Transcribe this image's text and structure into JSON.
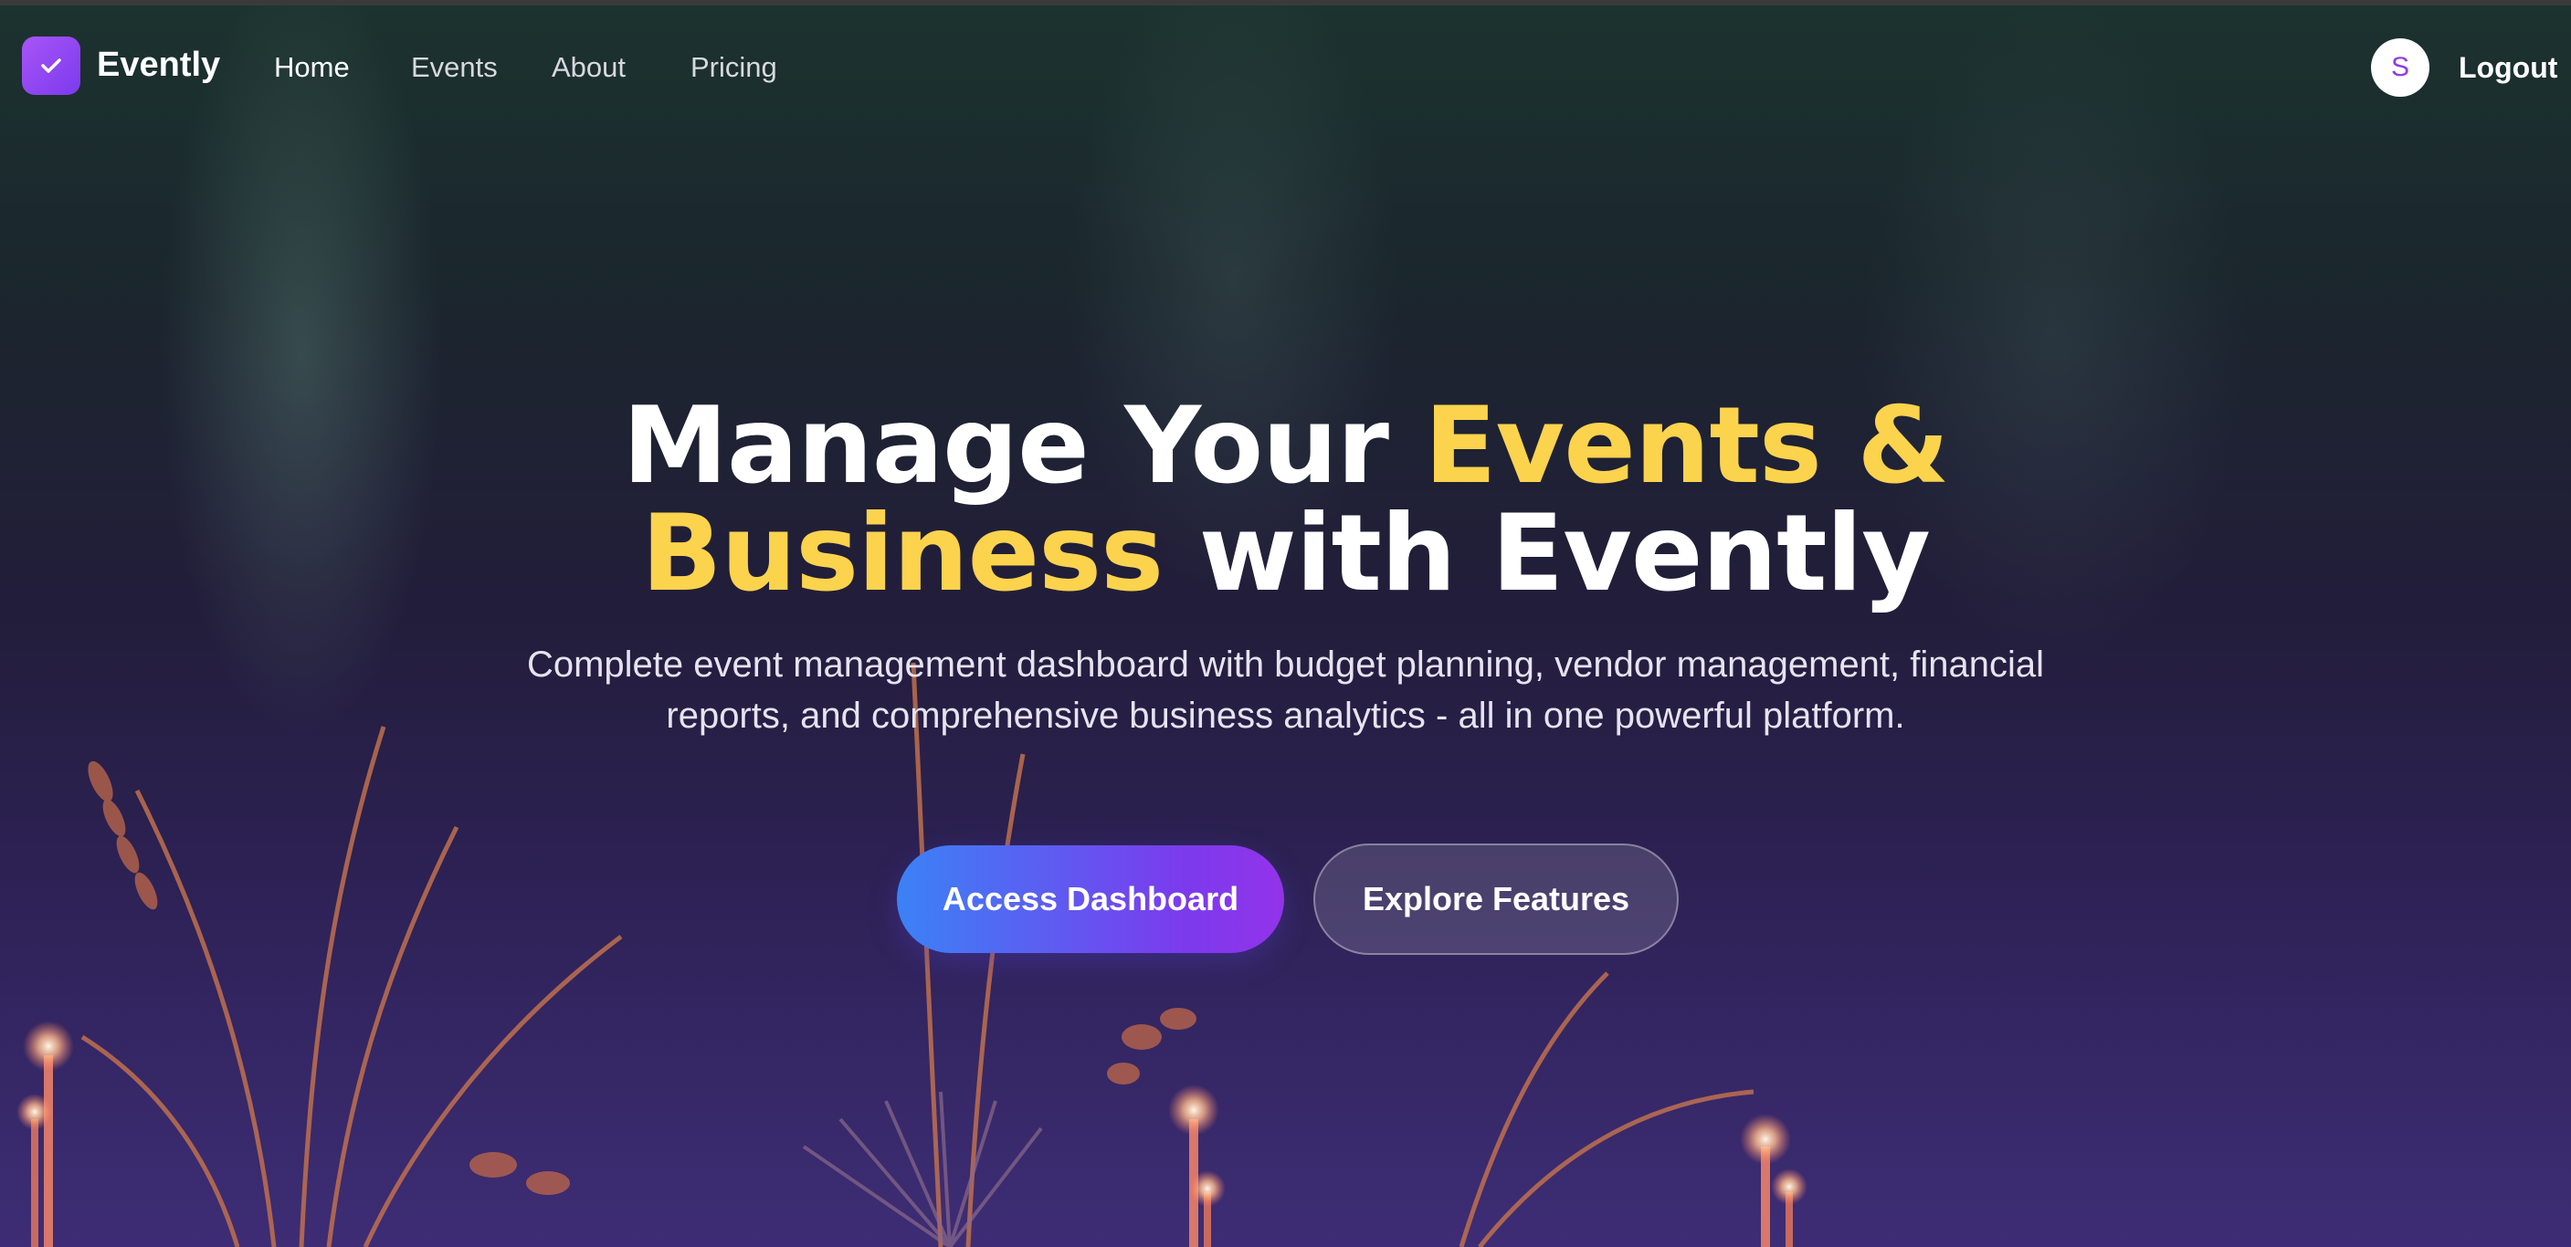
{
  "navbar": {
    "brand": "Evently",
    "links": [
      {
        "label": "Home",
        "active": true
      },
      {
        "label": "Events",
        "active": false
      },
      {
        "label": "About",
        "active": false
      },
      {
        "label": "Pricing",
        "active": false
      }
    ],
    "avatar_initial": "S",
    "logout_label": "Logout"
  },
  "hero": {
    "headline": {
      "part1": "Manage Your ",
      "part2": "Events &",
      "part3": "Business",
      "part4": " with Evently"
    },
    "subtitle": "Complete event management dashboard with budget planning, vendor management, financial reports, and comprehensive business analytics - all in one powerful platform.",
    "primary_button": "Access Dashboard",
    "secondary_button": "Explore Features"
  },
  "colors": {
    "accent_yellow": "#fcd34d",
    "brand_purple": "#7c3aed",
    "primary_blue": "#3b82f6"
  },
  "icons": {
    "logo": "check-icon"
  }
}
